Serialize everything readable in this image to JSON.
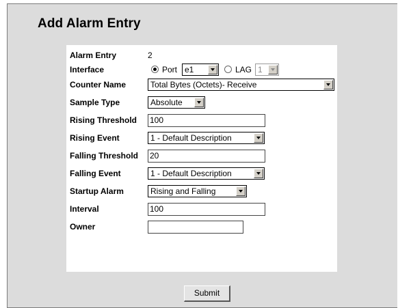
{
  "page": {
    "title": "Add Alarm Entry"
  },
  "form": {
    "alarm_entry": {
      "label": "Alarm Entry",
      "value": "2"
    },
    "interface": {
      "label": "Interface",
      "port_label": "Port",
      "port_value": "e1",
      "lag_label": "LAG",
      "lag_value": "1",
      "selected": "Port"
    },
    "counter_name": {
      "label": "Counter Name",
      "value": "Total Bytes (Octets)- Receive"
    },
    "sample_type": {
      "label": "Sample Type",
      "value": "Absolute"
    },
    "rising_threshold": {
      "label": "Rising Threshold",
      "value": "100"
    },
    "rising_event": {
      "label": "Rising Event",
      "value": "1 - Default Description"
    },
    "falling_threshold": {
      "label": "Falling Threshold",
      "value": "20"
    },
    "falling_event": {
      "label": "Falling Event",
      "value": "1 - Default Description"
    },
    "startup_alarm": {
      "label": "Startup Alarm",
      "value": "Rising and Falling"
    },
    "interval": {
      "label": "Interval",
      "value": "100"
    },
    "owner": {
      "label": "Owner",
      "value": ""
    }
  },
  "actions": {
    "submit_label": "Submit"
  }
}
